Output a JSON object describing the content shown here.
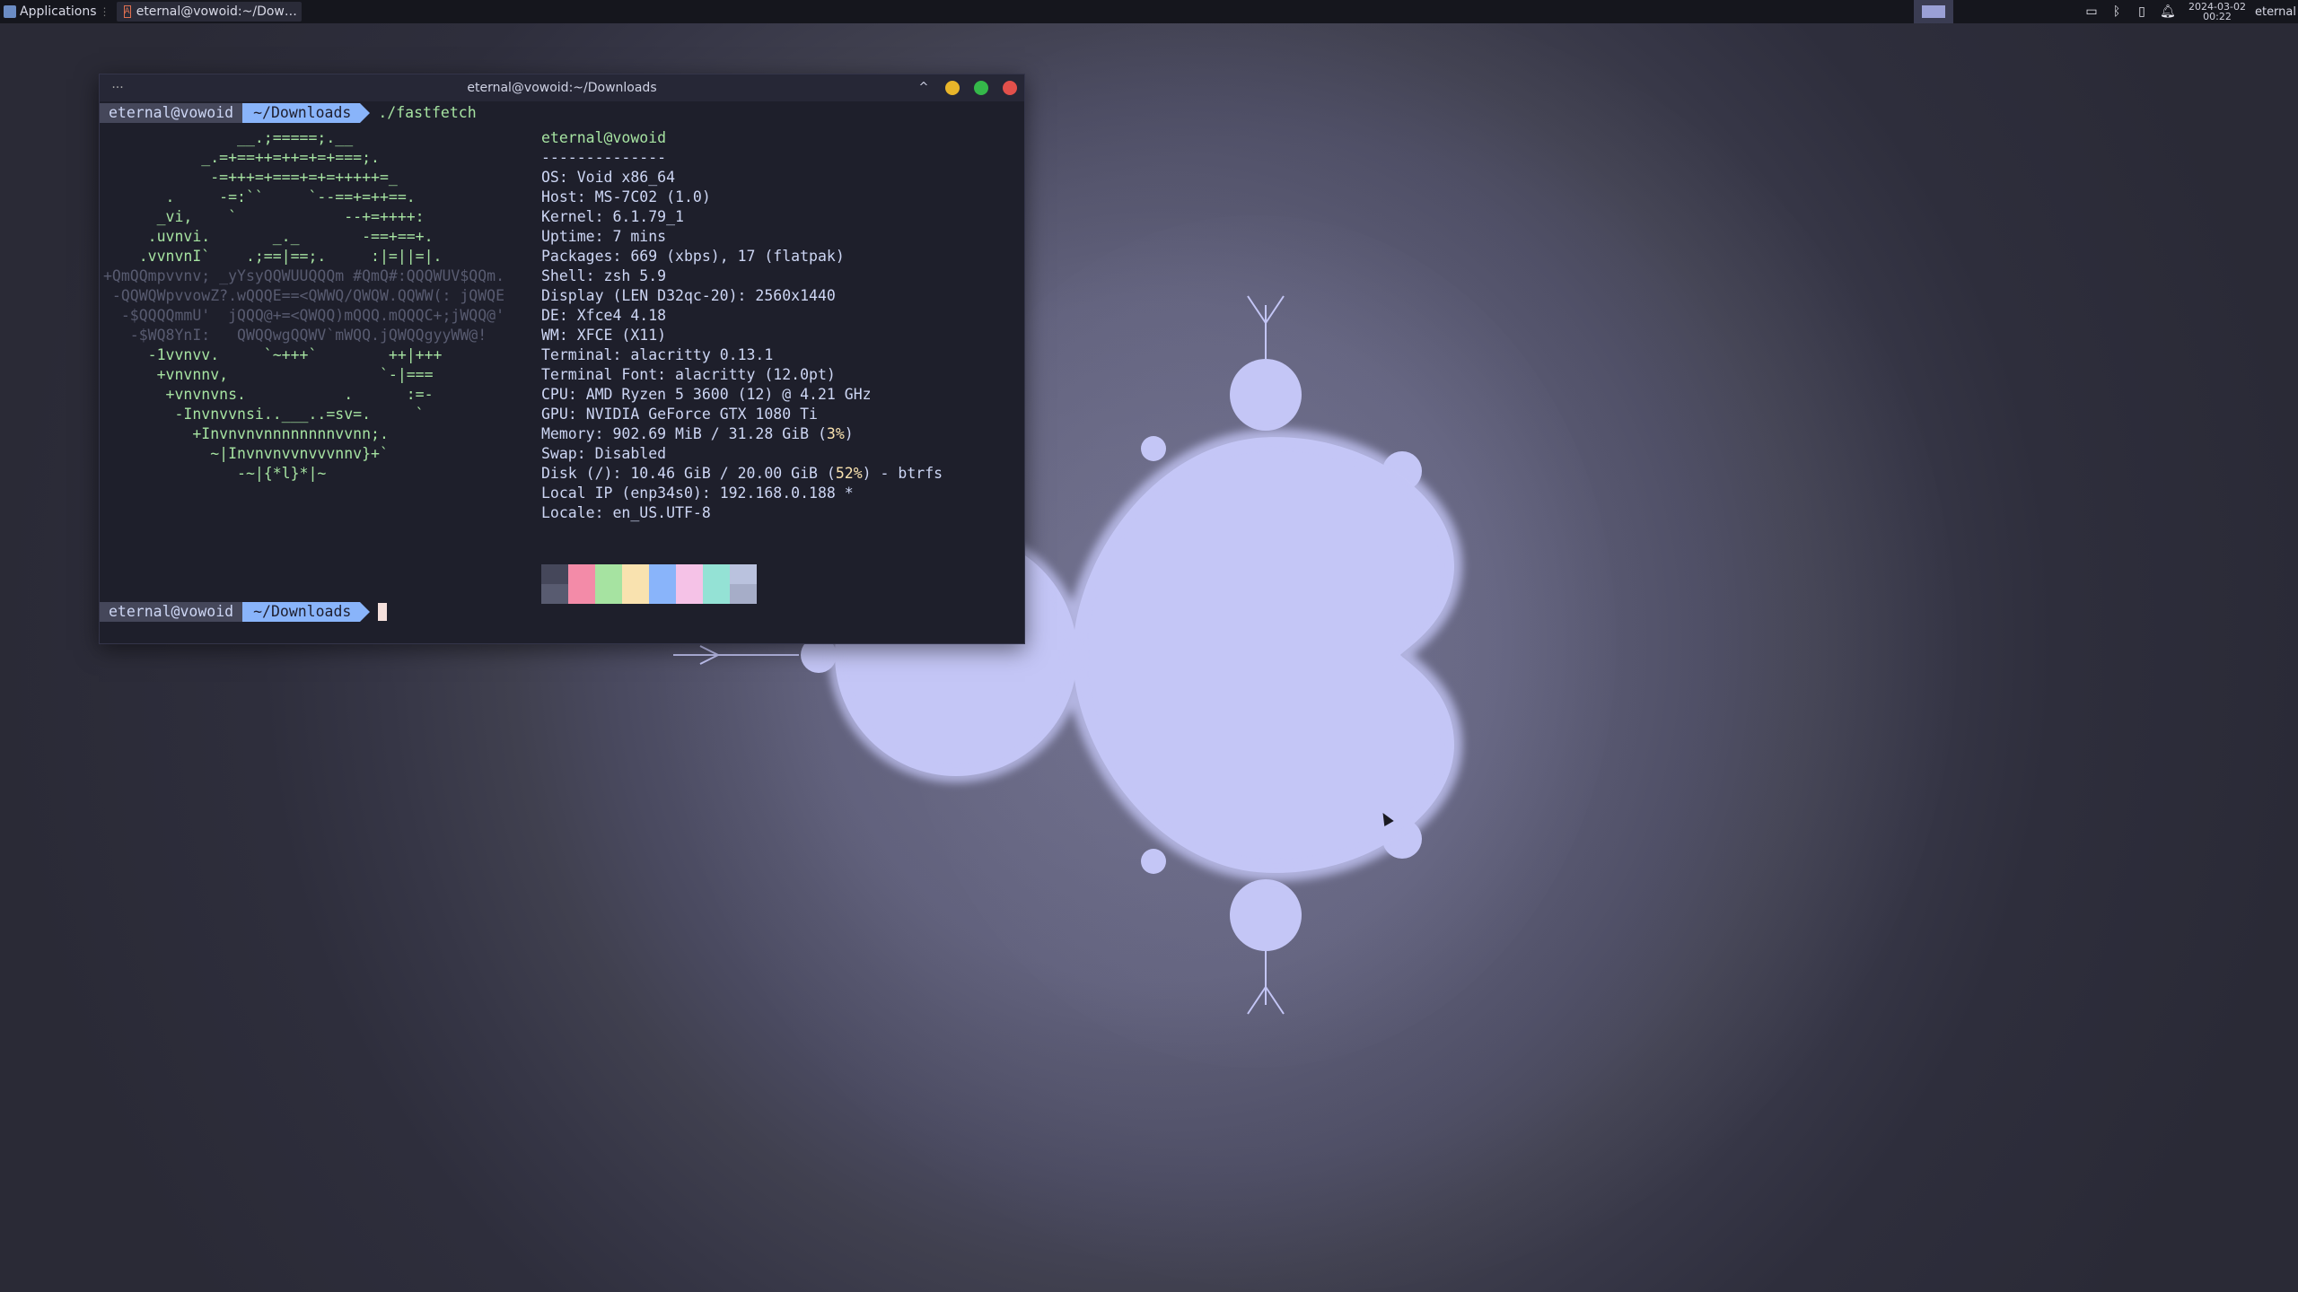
{
  "panel": {
    "apps_label": "Applications",
    "task_title": "eternal@vowoid:~/Dow…",
    "clock_date": "2024-03-02",
    "clock_time": "00:22",
    "user": "eternal",
    "tray_icons": [
      "window-icon",
      "bluetooth-icon",
      "battery-icon",
      "bell-icon"
    ]
  },
  "window": {
    "title": "eternal@vowoid:~/Downloads",
    "dots": "···",
    "up_glyph": "^"
  },
  "prompt": {
    "user": "eternal@vowoid",
    "dir": "~/Downloads",
    "command": "./fastfetch"
  },
  "ascii_art": [
    "               __.;=====;.__",
    "           _.=+==++=++=+=+===;.",
    "            -=+++=+===+=+=+++++=_",
    "       .     -=:``     `--==+=++==.",
    "      _vi,    `            --+=++++:",
    "     .uvnvi.       _._       -==+==+.",
    "    .vvnvnI`    .;==|==;.     :|=||=|.",
    "+QmQQmpvvnv; _yYsyQQWUUQQQm #QmQ#:QQQWUV$QQm.",
    " -QQWQWpvvowZ?.wQQQE==<QWWQ/QWQW.QQWW(: jQWQE",
    "  -$QQQQmmU'  jQQQ@+=<QWQQ)mQQQ.mQQQC+;jWQQ@'",
    "   -$WQ8YnI:   QWQQwgQQWV`mWQQ.jQWQQgyyWW@!",
    "     -1vvnvv.     `~+++`        ++|+++",
    "      +vnvnnv,                 `-|===",
    "       +vnvnvns.           .      :=-",
    "        -Invnvvnsi..___..=sv=.     `",
    "          +Invnvnvnnnnnnnnvvnn;.",
    "            ~|Invnvnvvnvvvnnv}+`",
    "               -~|{*l}*|~"
  ],
  "info": {
    "title": "eternal@vowoid",
    "separator": "--------------",
    "lines": [
      {
        "key": "OS",
        "value": "Void x86_64"
      },
      {
        "key": "Host",
        "value": "MS-7C02 (1.0)"
      },
      {
        "key": "Kernel",
        "value": "6.1.79_1"
      },
      {
        "key": "Uptime",
        "value": "7 mins"
      },
      {
        "key": "Packages",
        "value": "669 (xbps), 17 (flatpak)"
      },
      {
        "key": "Shell",
        "value": "zsh 5.9"
      },
      {
        "key": "Display (LEN D32qc-20)",
        "value": "2560x1440"
      },
      {
        "key": "DE",
        "value": "Xfce4 4.18"
      },
      {
        "key": "WM",
        "value": "XFCE (X11)"
      },
      {
        "key": "Terminal",
        "value": "alacritty 0.13.1"
      },
      {
        "key": "Terminal Font",
        "value": "alacritty (12.0pt)"
      },
      {
        "key": "CPU",
        "value": "AMD Ryzen 5 3600 (12) @ 4.21 GHz"
      },
      {
        "key": "GPU",
        "value": "NVIDIA GeForce GTX 1080 Ti"
      },
      {
        "key": "Memory",
        "value": "902.69 MiB / 31.28 GiB (",
        "pct": "3%",
        "tail": ")"
      },
      {
        "key": "Swap",
        "value": "Disabled"
      },
      {
        "key": "Disk (/)",
        "value": "10.46 GiB / 20.00 GiB (",
        "pct": "52%",
        "tail": ") - btrfs"
      },
      {
        "key": "Local IP (enp34s0)",
        "value": "192.168.0.188 *"
      },
      {
        "key": "Locale",
        "value": "en_US.UTF-8"
      }
    ]
  },
  "palette": {
    "top": [
      "#45475a",
      "#f38ba8",
      "#a6e3a1",
      "#f9e2af",
      "#89b4fa",
      "#f5c2e7",
      "#94e2d5",
      "#bac2de"
    ],
    "bottom": [
      "#585b70",
      "#f38ba8",
      "#a6e3a1",
      "#f9e2af",
      "#89b4fa",
      "#f5c2e7",
      "#94e2d5",
      "#a6adc8"
    ]
  },
  "colors": {
    "fractal": "#c4c6f6",
    "terminal_bg": "#1e1f2b"
  }
}
